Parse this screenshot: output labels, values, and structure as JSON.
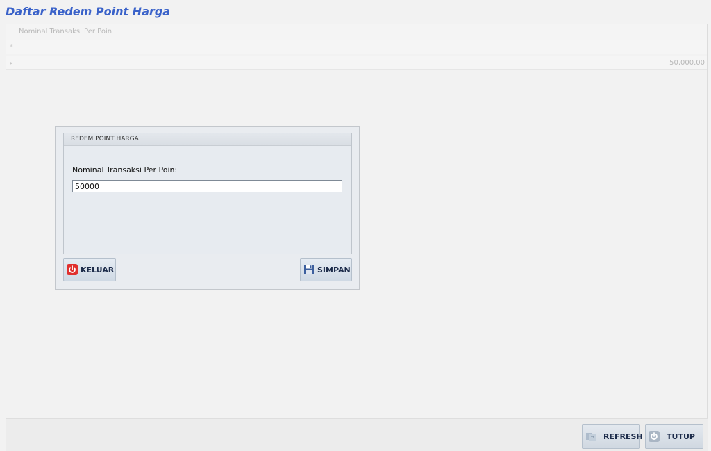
{
  "page": {
    "title": "Daftar Redem Point Harga"
  },
  "grid": {
    "columns": [
      "Nominal Transaksi Per Poin"
    ],
    "rows": [
      {
        "indicator": "*",
        "value": ""
      },
      {
        "indicator": "▸",
        "value": "50,000.00"
      }
    ]
  },
  "dialog": {
    "group_caption": "REDEM POINT HARGA",
    "field_label": "Nominal Transaksi Per Poin:",
    "field_value": "50000",
    "keluar_label": "KELUAR",
    "simpan_label": "SIMPAN"
  },
  "footer": {
    "refresh_label": "REFRESH",
    "tutup_label": "TUTUP"
  },
  "colors": {
    "title": "#3a62c9",
    "keluar_icon": "#e0302e",
    "simpan_icon": "#3c5f9e"
  },
  "icons": {
    "keluar": "power-icon",
    "simpan": "floppy-disk-icon",
    "refresh": "refresh-icon",
    "tutup": "power-icon"
  }
}
